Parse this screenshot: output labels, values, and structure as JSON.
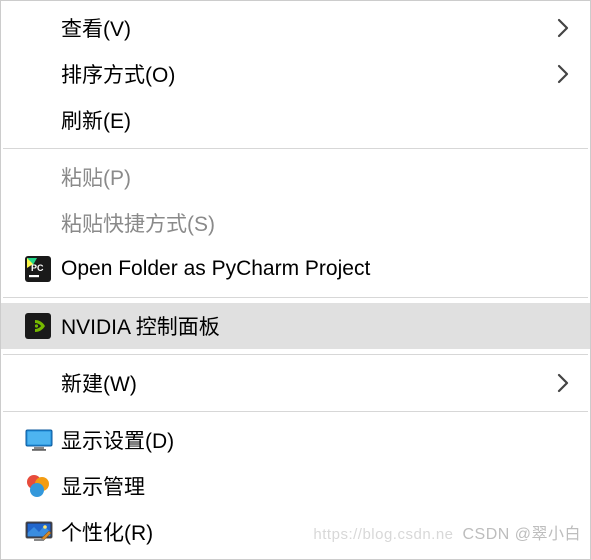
{
  "menu": {
    "items": [
      {
        "label": "查看(V)",
        "has_submenu": true
      },
      {
        "label": "排序方式(O)",
        "has_submenu": true
      },
      {
        "label": "刷新(E)"
      },
      {
        "label": "粘贴(P)",
        "disabled": true
      },
      {
        "label": "粘贴快捷方式(S)",
        "disabled": true
      },
      {
        "label": "Open Folder as PyCharm Project",
        "icon": "pycharm-icon"
      },
      {
        "label": "NVIDIA 控制面板",
        "icon": "nvidia-icon",
        "hovered": true
      },
      {
        "label": "新建(W)",
        "has_submenu": true
      },
      {
        "label": "显示设置(D)",
        "icon": "display-settings-icon"
      },
      {
        "label": "显示管理",
        "icon": "display-management-icon"
      },
      {
        "label": "个性化(R)",
        "icon": "personalize-icon"
      }
    ]
  },
  "watermark": {
    "left": "https://blog.csdn.ne",
    "right": "CSDN @翠小白"
  }
}
